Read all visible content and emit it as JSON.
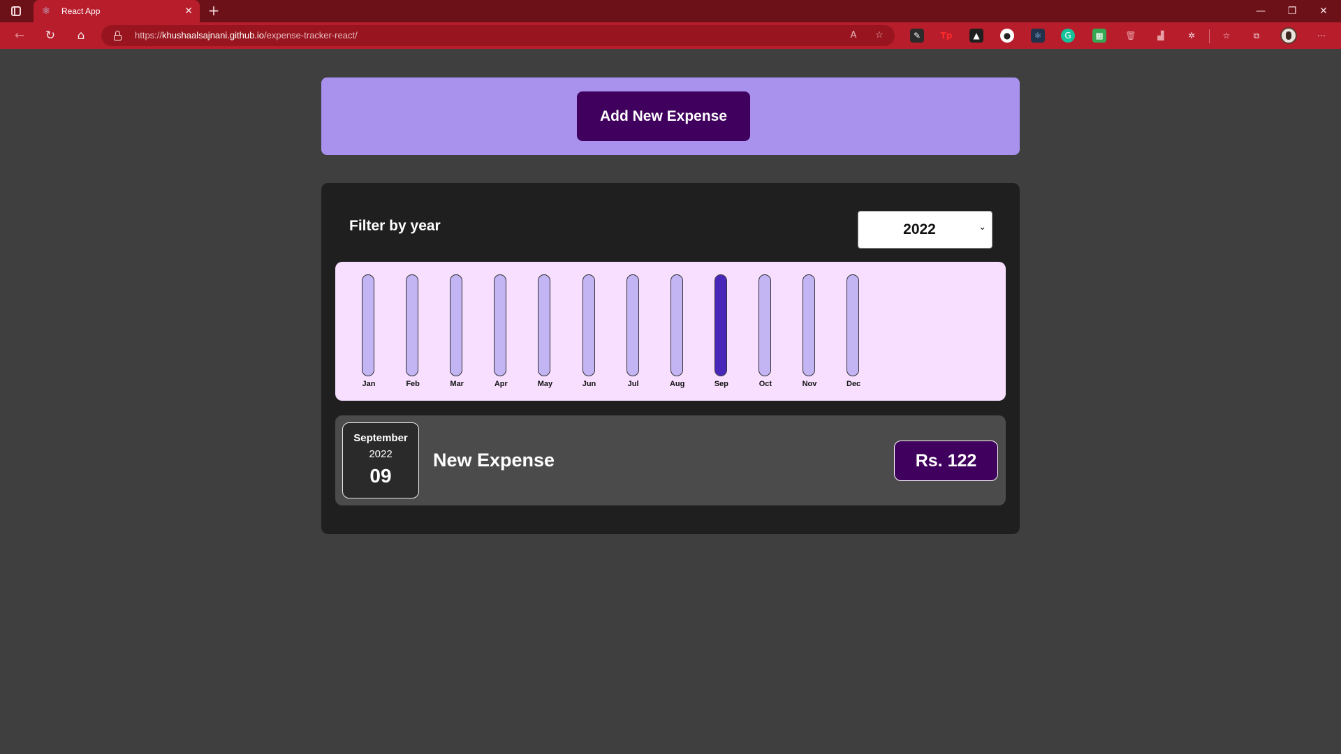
{
  "browser": {
    "tab_title": "React App",
    "url_prefix": "https://",
    "url_host": "khushaalsajnani.github.io",
    "url_path": "/expense-tracker-react/"
  },
  "new_expense": {
    "button_label": "Add New Expense"
  },
  "filter": {
    "label": "Filter by year",
    "selected_year": "2022"
  },
  "chart_data": {
    "type": "bar",
    "categories": [
      "Jan",
      "Feb",
      "Mar",
      "Apr",
      "May",
      "Jun",
      "Jul",
      "Aug",
      "Sep",
      "Oct",
      "Nov",
      "Dec"
    ],
    "values": [
      0,
      0,
      0,
      0,
      0,
      0,
      0,
      0,
      122,
      0,
      0,
      0
    ],
    "ylim": [
      0,
      122
    ],
    "colors": {
      "track": "#c3b4f3",
      "fill": "#4826b9",
      "background": "#f8dfff"
    }
  },
  "expense": {
    "month": "September",
    "year": "2022",
    "day": "09",
    "title": "New Expense",
    "amount": "Rs. 122"
  },
  "colors": {
    "accent": "#40005d",
    "new_expense_bg": "#a892ee",
    "page_bg": "#3f3f3f"
  }
}
